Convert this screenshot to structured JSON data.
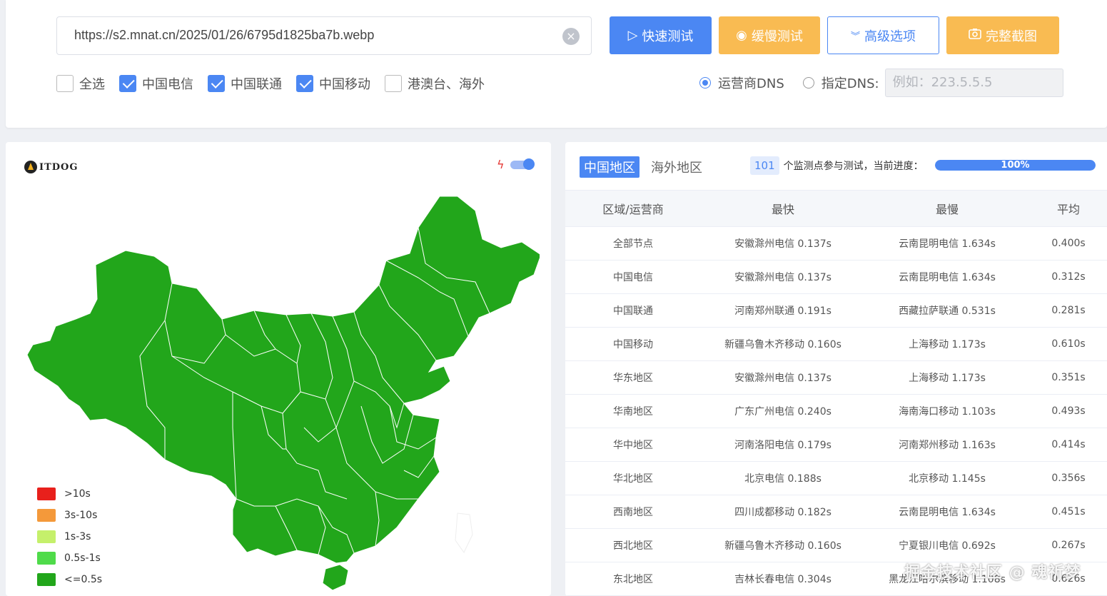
{
  "search": {
    "url_value": "https://s2.mnat.cn/2025/01/26/6795d1825ba7b.webp",
    "clear_icon": "close-circle-icon"
  },
  "buttons": {
    "fast_test": "快速测试",
    "slow_test": "缓慢测试",
    "advanced": "高级选项",
    "screenshot": "完整截图"
  },
  "filters": [
    {
      "label": "全选",
      "checked": false
    },
    {
      "label": "中国电信",
      "checked": true
    },
    {
      "label": "中国联通",
      "checked": true
    },
    {
      "label": "中国移动",
      "checked": true
    },
    {
      "label": "港澳台、海外",
      "checked": false
    }
  ],
  "dns": {
    "option_carrier": "运营商DNS",
    "option_custom": "指定DNS:",
    "selected": "运营商DNS",
    "custom_placeholder": "例如：223.5.5.5"
  },
  "map": {
    "logo_text": "ITDOG",
    "legend": [
      {
        "label": ">10s",
        "color": "#e8201c"
      },
      {
        "label": "3s-10s",
        "color": "#f4993a"
      },
      {
        "label": "1s-3s",
        "color": "#c5f06b"
      },
      {
        "label": "0.5s-1s",
        "color": "#4fdb4a"
      },
      {
        "label": "<=0.5s",
        "color": "#22a61b"
      }
    ],
    "fill_color": "#22a61b"
  },
  "results": {
    "tab_china": "中国地区",
    "tab_overseas": "海外地区",
    "monitor_count": "101",
    "monitor_text": "个监测点参与测试，当前进度：",
    "progress_label": "100%",
    "progress_value": 100,
    "headers": [
      "区域/运营商",
      "最快",
      "最慢",
      "平均"
    ],
    "rows": [
      [
        "全部节点",
        "安徽滁州电信 0.137s",
        "云南昆明电信 1.634s",
        "0.400s"
      ],
      [
        "中国电信",
        "安徽滁州电信 0.137s",
        "云南昆明电信 1.634s",
        "0.312s"
      ],
      [
        "中国联通",
        "河南郑州联通 0.191s",
        "西藏拉萨联通 0.531s",
        "0.281s"
      ],
      [
        "中国移动",
        "新疆乌鲁木齐移动 0.160s",
        "上海移动 1.173s",
        "0.610s"
      ],
      [
        "华东地区",
        "安徽滁州电信 0.137s",
        "上海移动 1.173s",
        "0.351s"
      ],
      [
        "华南地区",
        "广东广州电信 0.240s",
        "海南海口移动 1.103s",
        "0.493s"
      ],
      [
        "华中地区",
        "河南洛阳电信 0.179s",
        "河南郑州移动 1.163s",
        "0.414s"
      ],
      [
        "华北地区",
        "北京电信 0.188s",
        "北京移动 1.145s",
        "0.356s"
      ],
      [
        "西南地区",
        "四川成都移动 0.182s",
        "云南昆明电信 1.634s",
        "0.451s"
      ],
      [
        "西北地区",
        "新疆乌鲁木齐移动 0.160s",
        "宁夏银川电信 0.692s",
        "0.267s"
      ],
      [
        "东北地区",
        "吉林长春电信 0.304s",
        "黑龙江哈尔滨移动 1.108s",
        "0.626s"
      ]
    ]
  },
  "watermark": "掘金技术社区 @ 魂祈梦",
  "colors": {
    "primary": "#4b87f3",
    "warning": "#f9bb52"
  }
}
